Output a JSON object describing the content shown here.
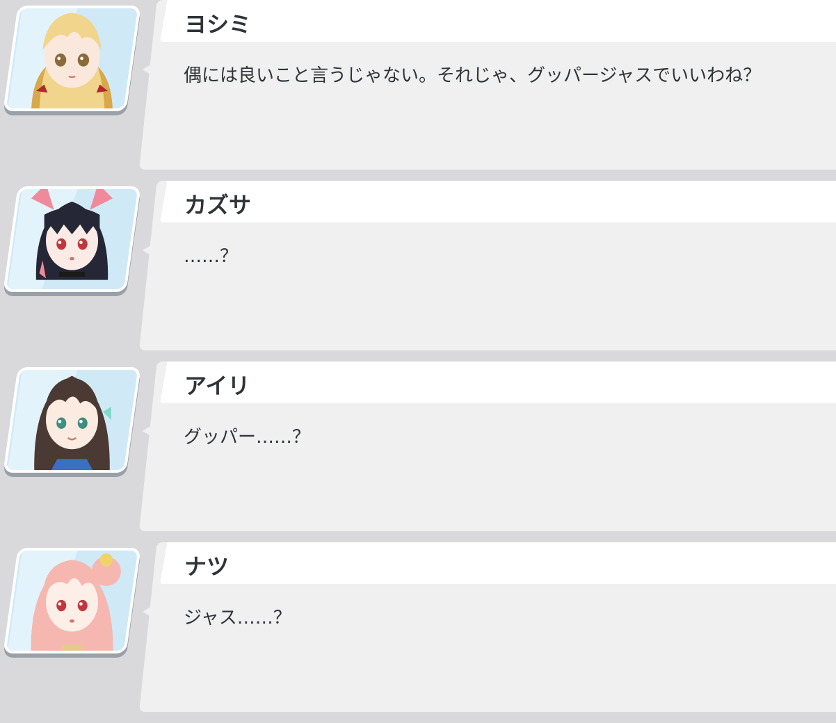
{
  "dialogue": [
    {
      "speaker": "ヨシミ",
      "text": "偶には良いこと言うじゃない。それじゃ、グッパージャスでいいわね？",
      "avatar": {
        "icon": "yoshimi-portrait",
        "hair": "#f2d58c",
        "hair_dark": "#d9b564",
        "eyes": "#8b6a3a",
        "accent": "#b3282d",
        "bg": "#cfe9f7"
      }
    },
    {
      "speaker": "カズサ",
      "text": "……？",
      "avatar": {
        "icon": "kazusa-portrait",
        "hair": "#252636",
        "hair_dark": "#111118",
        "eyes": "#c0383d",
        "accent": "#f08a9a",
        "bg": "#cfe9f7"
      }
    },
    {
      "speaker": "アイリ",
      "text": "グッパー……？",
      "avatar": {
        "icon": "airi-portrait",
        "hair": "#4a3a33",
        "hair_dark": "#2e231f",
        "eyes": "#3f8f80",
        "accent": "#7fd9c8",
        "bg": "#cfe9f7"
      }
    },
    {
      "speaker": "ナツ",
      "text": "ジャス……？",
      "avatar": {
        "icon": "natsu-portrait",
        "hair": "#f6b7b0",
        "hair_dark": "#e89a92",
        "eyes": "#c0383d",
        "accent": "#f2d36b",
        "bg": "#cfe9f7"
      }
    }
  ]
}
